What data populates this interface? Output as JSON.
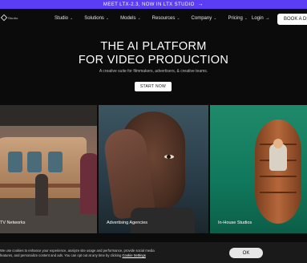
{
  "announcement": {
    "text": "MEET LTX-2.3, NOW IN LTX STUDIO",
    "arrow": "→"
  },
  "nav": {
    "logo_text": "Studio",
    "items": [
      {
        "label": "Studio",
        "chevron": "⌄"
      },
      {
        "label": "Solutions",
        "chevron": "⌄"
      },
      {
        "label": "Models",
        "chevron": "⌄"
      },
      {
        "label": "Resources",
        "chevron": "⌄"
      },
      {
        "label": "Company",
        "chevron": "⌄"
      },
      {
        "label": "Pricing",
        "chevron": "⌄"
      }
    ],
    "login_label": "Login",
    "login_arrow": "→",
    "book_label": "BOOK A DEMO"
  },
  "hero": {
    "title_line1": "THE AI PLATFORM",
    "title_line2": "FOR VIDEO PRODUCTION",
    "subtitle": "A creative suite for filmmakers, advertisers, & creative teams.",
    "cta_label": "START NOW"
  },
  "cards": [
    {
      "caption": "TV Networks"
    },
    {
      "caption": "Advertising Agencies"
    },
    {
      "caption": "In-House Studios"
    }
  ],
  "cookie": {
    "text_line1": "We use cookies to enhance your experience, analyze site usage and performance, provide social media",
    "text_line2": "features, and personalize content and ads. You can opt out at any time by clicking",
    "link_label": "Cookie Settings",
    "ok_label": "OK"
  }
}
